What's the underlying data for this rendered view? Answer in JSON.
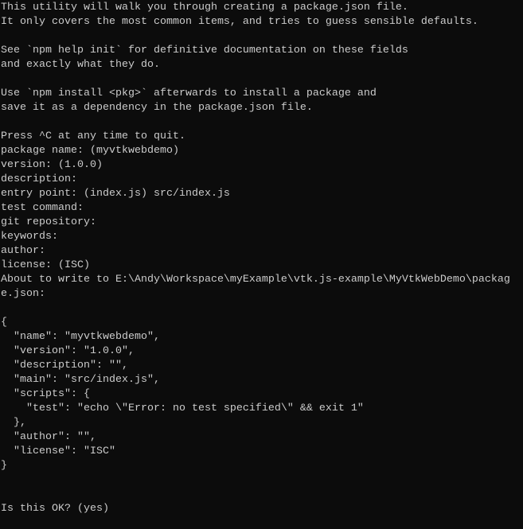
{
  "terminal": {
    "lines": [
      "This utility will walk you through creating a package.json file.",
      "It only covers the most common items, and tries to guess sensible defaults.",
      "",
      "See `npm help init` for definitive documentation on these fields",
      "and exactly what they do.",
      "",
      "Use `npm install <pkg>` afterwards to install a package and",
      "save it as a dependency in the package.json file.",
      "",
      "Press ^C at any time to quit.",
      "package name: (myvtkwebdemo)",
      "version: (1.0.0)",
      "description:",
      "entry point: (index.js) src/index.js",
      "test command:",
      "git repository:",
      "keywords:",
      "author:",
      "license: (ISC)",
      "About to write to E:\\Andy\\Workspace\\myExample\\vtk.js-example\\MyVtkWebDemo\\packag",
      "e.json:",
      "",
      "{",
      "  \"name\": \"myvtkwebdemo\",",
      "  \"version\": \"1.0.0\",",
      "  \"description\": \"\",",
      "  \"main\": \"src/index.js\",",
      "  \"scripts\": {",
      "    \"test\": \"echo \\\"Error: no test specified\\\" && exit 1\"",
      "  },",
      "  \"author\": \"\",",
      "  \"license\": \"ISC\"",
      "}",
      "",
      "",
      "Is this OK? (yes)"
    ],
    "colors": {
      "background": "#0c0c0c",
      "text": "#cccccc"
    }
  }
}
